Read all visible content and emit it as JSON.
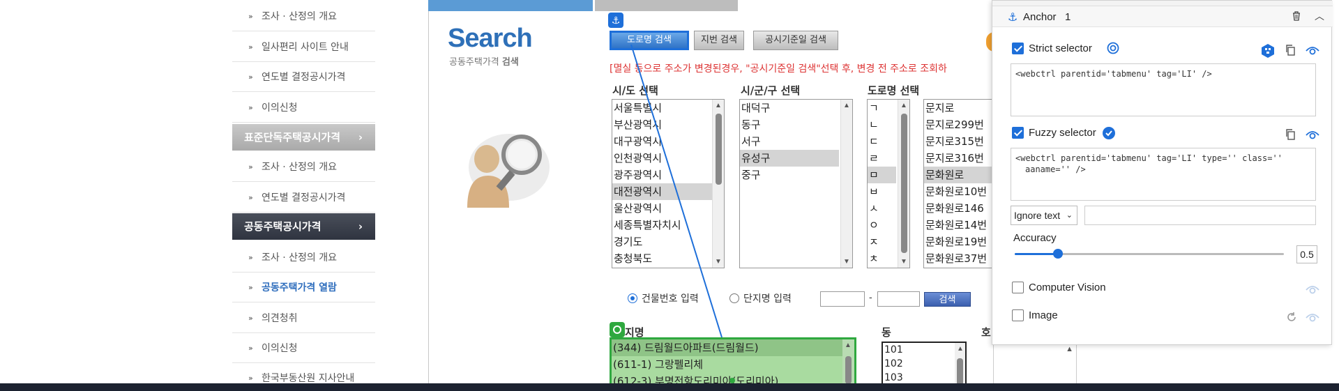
{
  "sidebar": {
    "items": [
      {
        "label": "조사 · 산정의 개요",
        "active": false
      },
      {
        "label": "일사편리 사이트 안내",
        "active": false
      },
      {
        "label": "연도별 결정공시가격",
        "active": false
      },
      {
        "label": "이의신청",
        "active": false
      },
      {
        "category": "표준단독주택공시가격",
        "style": "gray",
        "arrow": "›"
      },
      {
        "label": "조사 · 산정의 개요",
        "active": false
      },
      {
        "label": "연도별 결정공시가격",
        "active": false
      },
      {
        "category": "공동주택공시가격",
        "style": "dark",
        "arrow": "›"
      },
      {
        "label": "조사 · 산정의 개요",
        "active": false
      },
      {
        "label": "공동주택가격 열람",
        "active": true
      },
      {
        "label": "의견청취",
        "active": false
      },
      {
        "label": "이의신청",
        "active": false
      },
      {
        "label": "한국부동산원 지사안내",
        "active": false
      }
    ]
  },
  "search": {
    "title": "Search",
    "subtitle_plain": "공동주택가격 ",
    "subtitle_bold": "검색"
  },
  "tabs": [
    {
      "label": "도로명 검색",
      "selected": true
    },
    {
      "label": "지번 검색",
      "selected": false
    },
    {
      "label": "공시기준일 검색",
      "selected": false
    }
  ],
  "notice": "[멸실 등으로 주소가 변경된경우, \"공시기준일 검색\"선택 후, 변경 전 주소로 조회하",
  "columns": {
    "sido": {
      "header": "시/도 선택",
      "options": [
        "서울특별시",
        "부산광역시",
        "대구광역시",
        "인천광역시",
        "광주광역시",
        "대전광역시",
        "울산광역시",
        "세종특별자치시",
        "경기도",
        "충청북도"
      ],
      "selected": "대전광역시"
    },
    "sigungu": {
      "header": "시/군/구 선택",
      "options": [
        "대덕구",
        "동구",
        "서구",
        "유성구",
        "중구"
      ],
      "selected": "유성구"
    },
    "initial": {
      "header": "도로명 선택",
      "options": [
        "ㄱ",
        "ㄴ",
        "ㄷ",
        "ㄹ",
        "ㅁ",
        "ㅂ",
        "ㅅ",
        "ㅇ",
        "ㅈ",
        "ㅊ"
      ],
      "selected": "ㅁ"
    },
    "road": {
      "options": [
        "문지로",
        "문지로299번",
        "문지로315번",
        "문지로316번",
        "문화원로",
        "문화원로10번",
        "문화원로146",
        "문화원로14번",
        "문화원로19번",
        "문화원로37번"
      ],
      "selected": "문화원로"
    }
  },
  "input_mode": {
    "building_label": "건물번호 입력",
    "complex_label": "단지명 입력",
    "selected": "building",
    "separator": "-",
    "search_button": "검색"
  },
  "results": {
    "complex_header": "단지명",
    "complex_header_visible": "지명",
    "complexes": [
      "(344) 드림월드아파트(드림월드)",
      "(611-1) 그랑펠리체",
      "(612-3) 부명전항도리미아(도리미아)"
    ],
    "dong_header": "동",
    "dongs": [
      "101",
      "102",
      "103"
    ],
    "ho_header": "호"
  },
  "panel": {
    "title": "Anchor",
    "count": "1",
    "strict": {
      "label": "Strict selector",
      "checked": true,
      "code": "<webctrl parentid='tabmenu' tag='LI' />"
    },
    "fuzzy": {
      "label": "Fuzzy selector",
      "checked": true,
      "code_line1": "<webctrl parentid='tabmenu' tag='LI' type='' class=''",
      "code_line2": "aaname='' />"
    },
    "ignore": {
      "option": "Ignore text",
      "value": ""
    },
    "accuracy": {
      "label": "Accuracy",
      "value": "0.5",
      "fraction": 0.16
    },
    "computer_vision": {
      "label": "Computer Vision",
      "checked": false
    },
    "image": {
      "label": "Image",
      "checked": false
    }
  },
  "colors": {
    "accent": "#1e6fd9",
    "highlight_green": "#2fa83f",
    "notice_red": "#dd3333"
  }
}
